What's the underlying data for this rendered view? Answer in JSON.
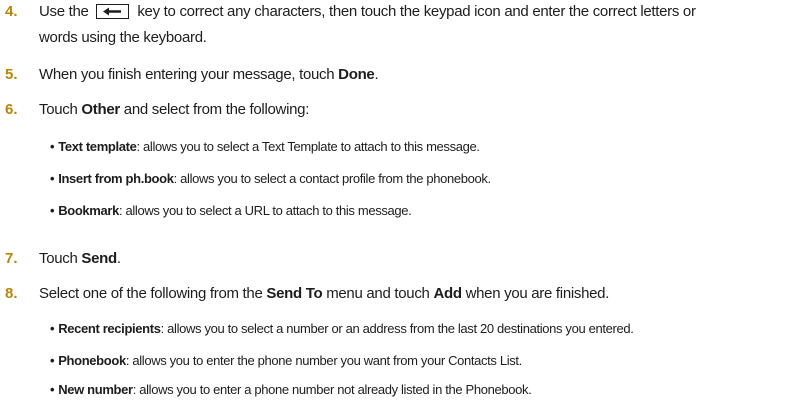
{
  "steps": [
    {
      "num": "4.",
      "pre": "Use the",
      "key_icon": "backspace-arrow-icon",
      "post": "key to correct any characters, then touch the keypad icon and enter the correct letters or",
      "cont": "words using the keyboard."
    },
    {
      "num": "5.",
      "pre": "When you finish entering your message, touch ",
      "bold": "Done",
      "post": "."
    },
    {
      "num": "6.",
      "pre": "Touch ",
      "bold": "Other",
      "post": " and select from the following:"
    },
    {
      "num": "7.",
      "pre": "Touch ",
      "bold": "Send",
      "post": "."
    },
    {
      "num": "8.",
      "pre": "Select one of the following from the ",
      "bold": "Send To",
      "mid": " menu and touch ",
      "bold2": "Add",
      "post": " when you are finished."
    }
  ],
  "bullets6": [
    {
      "term": "Text template",
      "desc": ": allows you to select a Text Template to attach to this message."
    },
    {
      "term": "Insert from ph.book",
      "desc": ": allows you to select a contact profile from the phonebook."
    },
    {
      "term": "Bookmark",
      "desc": ": allows you to select a URL to attach to this message."
    }
  ],
  "bullets8": [
    {
      "term": "Recent recipients",
      "desc": ": allows you to select a number or an address from the last 20 destinations you entered."
    },
    {
      "term": "Phonebook",
      "desc": ": allows you to enter the phone number you want from your Contacts List."
    },
    {
      "term": "New number",
      "desc": ": allows you to enter a phone number not already listed in the Phonebook."
    }
  ],
  "bullet_char": "•",
  "colors": {
    "step_number": "#b8860b",
    "text": "#1d1d1d"
  }
}
